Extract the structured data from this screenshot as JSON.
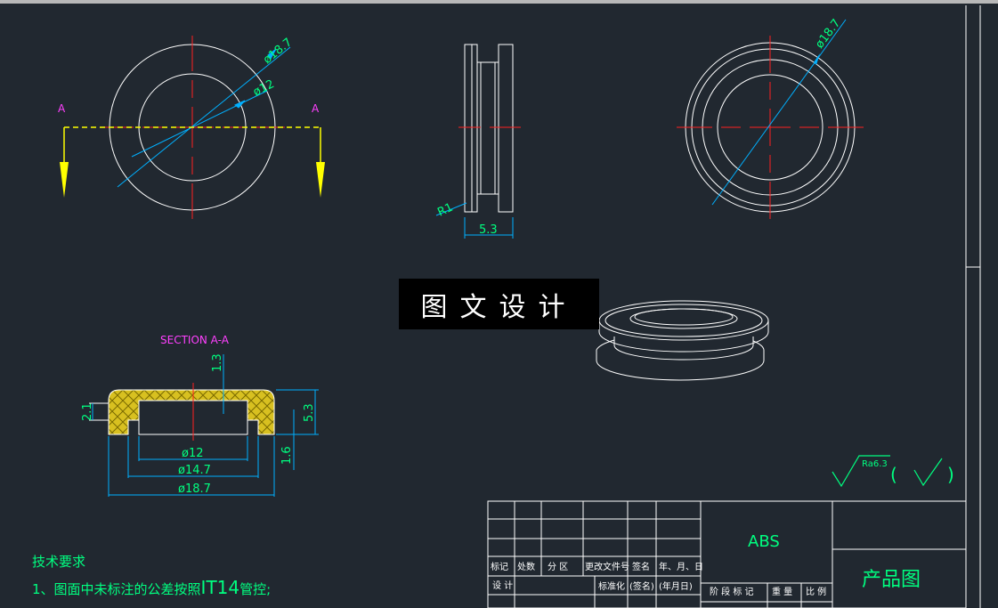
{
  "drawing": {
    "top_view": {
      "dia_outer": "ø18.7",
      "dia_inner": "ø12",
      "section_mark_left": "A",
      "section_mark_right": "A"
    },
    "side_view": {
      "radius": "R1",
      "width": "5.3"
    },
    "right_view": {
      "dia_outer": "ø18.7"
    },
    "section": {
      "title": "SECTION A-A",
      "dim_top": "1.3",
      "dim_left": "2.1",
      "dim_right_height": "5.3",
      "dim_right_lower": "1.6",
      "dim_d12": "ø12",
      "dim_d147": "ø14.7",
      "dim_d187": "ø18.7"
    },
    "roughness": {
      "value": "Ra6.3",
      "open": "(",
      "close": ")"
    },
    "notes": {
      "heading": "技术要求",
      "line1_prefix": "1、图面中未标注的公差按照",
      "line1_it": "IT14",
      "line1_suffix": "管控;"
    },
    "watermark": "图文设计",
    "title_block": {
      "material": "ABS",
      "drawing_name": "产品图",
      "row_labels": [
        "标记",
        "处数",
        "分 区",
        "更改文件号",
        "签名",
        "年、月、日"
      ],
      "design_row": [
        "设 计",
        "标准化",
        "(签名)",
        "(年月日)"
      ],
      "stage_row": [
        "阶 段 标 记",
        "重 量",
        "比 例"
      ]
    }
  }
}
